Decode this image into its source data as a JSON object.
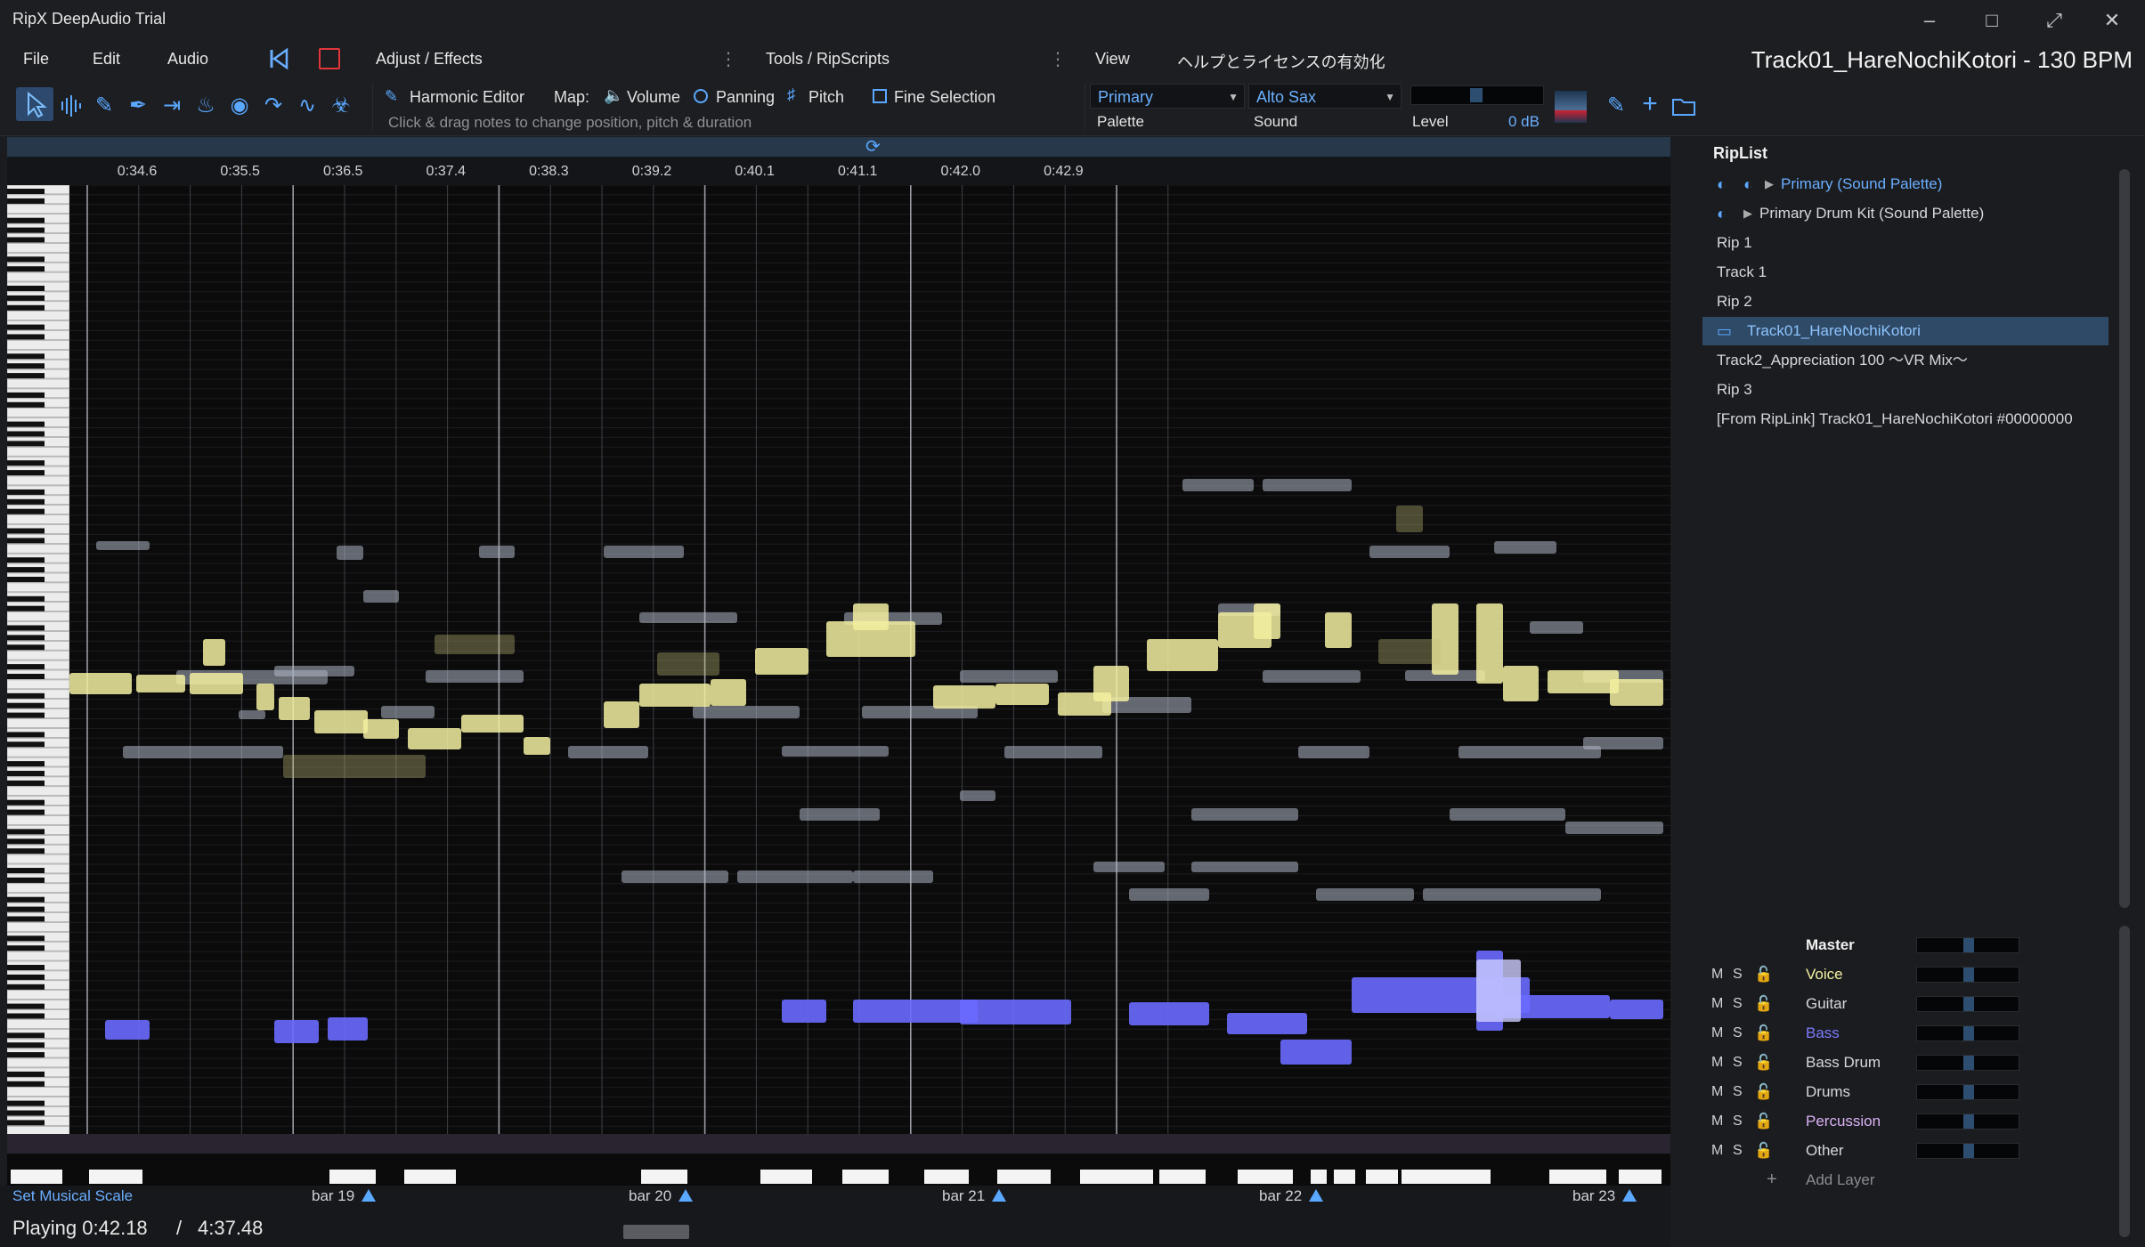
{
  "app": {
    "title": "RipX DeepAudio Trial"
  },
  "menu": {
    "file": "File",
    "edit": "Edit",
    "audio": "Audio",
    "adjust": "Adjust / Effects",
    "tools": "Tools / RipScripts",
    "view": "View",
    "help_jp": "ヘルプとライセンスの有効化"
  },
  "track_title": "Track01_HareNochiKotori - 130 BPM",
  "toolbar": {
    "harmonic_editor": "Harmonic Editor",
    "map": "Map:",
    "volume": "Volume",
    "panning": "Panning",
    "pitch": "Pitch",
    "fine_selection": "Fine Selection",
    "hint": "Click & drag notes to change position, pitch & duration",
    "palette_value": "Primary",
    "sound_value": "Alto Sax",
    "palette_label": "Palette",
    "sound_label": "Sound",
    "level_label": "Level",
    "level_value": "0 dB"
  },
  "ruler": {
    "times": [
      "0:34.6",
      "0:35.5",
      "0:36.5",
      "0:37.4",
      "0:38.3",
      "0:39.2",
      "0:40.1",
      "0:41.1",
      "0:42.0",
      "0:42.9"
    ]
  },
  "bars": {
    "set_scale": "Set Musical Scale",
    "labels": [
      "bar 19",
      "bar 20",
      "bar 21",
      "bar 22",
      "bar 23"
    ]
  },
  "status": {
    "playing": "Playing 0:42.18",
    "sep": "/",
    "total": "4:37.48"
  },
  "riplist": {
    "title": "RipList",
    "items": [
      {
        "label": "Primary (Sound Palette)",
        "icon": "folder-palette-icon"
      },
      {
        "label": "Primary Drum Kit (Sound Palette)",
        "icon": "palette-icon"
      },
      {
        "label": "Rip 1"
      },
      {
        "label": "Track 1"
      },
      {
        "label": "Rip 2"
      },
      {
        "label": "Track01_HareNochiKotori",
        "icon": "folder-icon"
      },
      {
        "label": "Track2_Appreciation 100 ～VR Mix～"
      },
      {
        "label": "Rip 3"
      },
      {
        "label": "[From RipLink] Track01_HareNochiKotori #00000000"
      }
    ]
  },
  "mixer": {
    "master": "Master",
    "m": "M",
    "s": "S",
    "layers": [
      {
        "name": "Voice",
        "color": "#f3efa0"
      },
      {
        "name": "Guitar",
        "color": "#d6d8dc"
      },
      {
        "name": "Bass",
        "color": "#7b7bff"
      },
      {
        "name": "Bass Drum",
        "color": "#d6d8dc"
      },
      {
        "name": "Drums",
        "color": "#d6d8dc"
      },
      {
        "name": "Percussion",
        "color": "#d9b2f5"
      },
      {
        "name": "Other",
        "color": "#d6d8dc"
      }
    ],
    "add_layer": "Add Layer"
  },
  "colors": {
    "accent": "#5aa8ff",
    "voice": "#f3efa0",
    "bass": "#6a6aff",
    "selection": "#2f4a66"
  }
}
